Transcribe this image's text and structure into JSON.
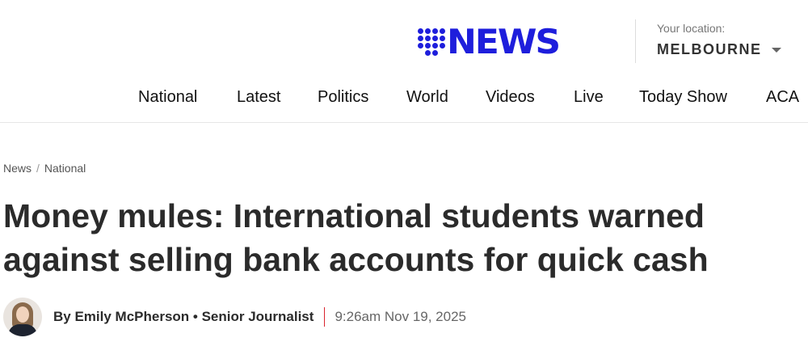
{
  "header": {
    "logo_text": "NEWS",
    "brand_color": "#1e1edc",
    "location_label": "Your location:",
    "location_value": "MELBOURNE"
  },
  "nav": {
    "items": [
      {
        "label": "National"
      },
      {
        "label": "Latest"
      },
      {
        "label": "Politics"
      },
      {
        "label": "World"
      },
      {
        "label": "Videos"
      },
      {
        "label": "Live"
      },
      {
        "label": "Today Show"
      },
      {
        "label": "ACA"
      }
    ]
  },
  "breadcrumb": {
    "items": [
      "News",
      "National"
    ],
    "separator": "/"
  },
  "article": {
    "headline": "Money mules: International students warned against selling bank accounts for quick cash",
    "author": "By Emily McPherson • Senior Journalist",
    "timestamp": "9:26am Nov 19, 2025",
    "accent_color": "#d9232e"
  }
}
